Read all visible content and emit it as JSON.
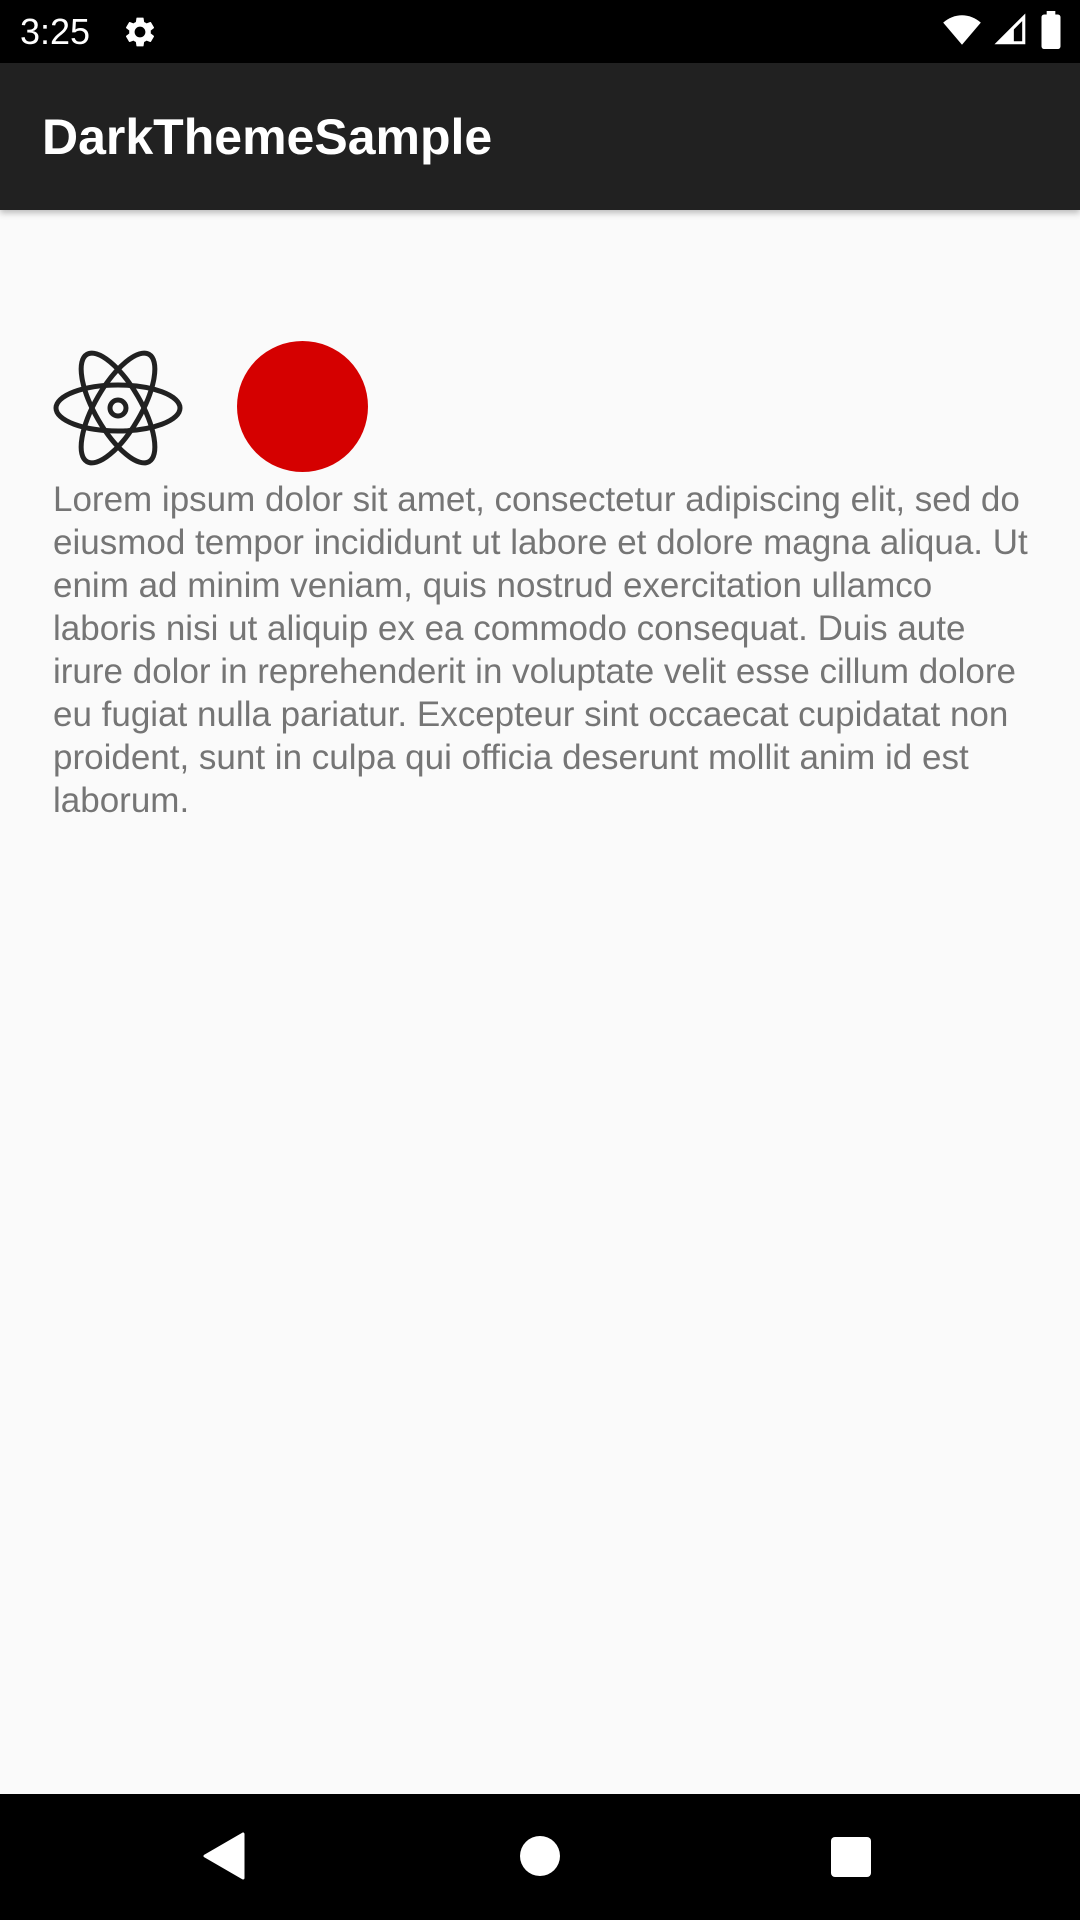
{
  "status_bar": {
    "time": "3:25",
    "icons": [
      "gear-icon",
      "wifi-icon",
      "cell-signal-icon",
      "battery-icon"
    ]
  },
  "app_bar": {
    "title": "DarkThemeSample"
  },
  "content": {
    "icons": [
      "atom-icon"
    ],
    "circle_color": "#d50000",
    "body_text": "Lorem ipsum dolor sit amet, consectetur adipiscing elit, sed do eiusmod tempor incididunt ut labore et dolore magna aliqua. Ut enim ad minim veniam, quis nostrud exercitation ullamco laboris nisi ut aliquip ex ea commodo consequat. Duis aute irure dolor in reprehenderit in voluptate velit esse cillum dolore eu fugiat nulla pariatur. Excepteur sint occaecat cupidatat non proident, sunt in culpa qui officia deserunt mollit anim id est laborum."
  },
  "nav_bar": {
    "buttons": [
      "back-icon",
      "home-icon",
      "recents-icon"
    ]
  },
  "colors": {
    "status_bar_bg": "#000000",
    "app_bar_bg": "#212121",
    "app_bar_text": "#ffffff",
    "background": "#fafafa",
    "body_text": "#757575",
    "nav_bar_bg": "#000000"
  }
}
